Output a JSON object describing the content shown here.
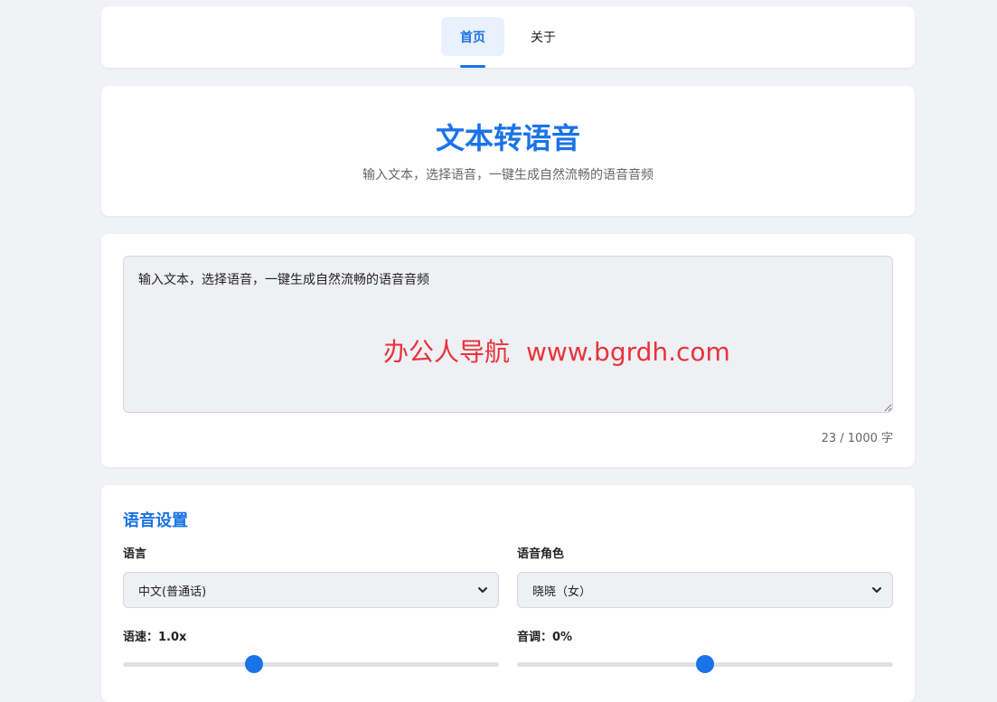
{
  "nav": {
    "items": [
      {
        "label": "首页",
        "active": true
      },
      {
        "label": "关于",
        "active": false
      }
    ]
  },
  "hero": {
    "title": "文本转语音",
    "subtitle": "输入文本，选择语音，一键生成自然流畅的语音音频"
  },
  "input": {
    "value": "输入文本，选择语音，一键生成自然流畅的语音音频",
    "counter": "23 / 1000 字"
  },
  "watermark": {
    "name": "办公人导航",
    "url": "www.bgrdh.com"
  },
  "settings": {
    "title": "语音设置",
    "language": {
      "label": "语言",
      "selected": "中文(普通话)"
    },
    "voice": {
      "label": "语音角色",
      "selected": "晓晓（女）"
    },
    "rate": {
      "label": "语速：1.0x",
      "fraction": 0.34
    },
    "pitch": {
      "label": "音调：0%",
      "fraction": 0.5
    }
  },
  "colors": {
    "accent": "#1a73e8",
    "watermark": "#e8333c",
    "background": "#f1f2f6"
  }
}
